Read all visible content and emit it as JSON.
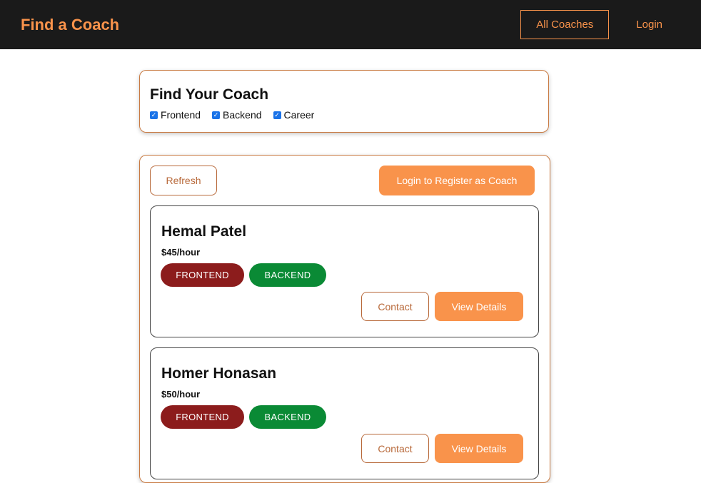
{
  "header": {
    "brand": "Find a Coach",
    "nav": [
      "All Coaches",
      "Login"
    ]
  },
  "filter": {
    "title": "Find Your Coach",
    "options": [
      {
        "label": "Frontend",
        "checked": true
      },
      {
        "label": "Backend",
        "checked": true
      },
      {
        "label": "Career",
        "checked": true
      }
    ]
  },
  "actions": {
    "refresh": "Refresh",
    "register": "Login to Register as Coach"
  },
  "coaches": [
    {
      "name": "Hemal Patel",
      "rate": "$45/hour",
      "areas": [
        "FRONTEND",
        "BACKEND"
      ],
      "contact": "Contact",
      "details": "View Details"
    },
    {
      "name": "Homer Honasan",
      "rate": "$50/hour",
      "areas": [
        "FRONTEND",
        "BACKEND"
      ],
      "contact": "Contact",
      "details": "View Details"
    }
  ],
  "colors": {
    "accent": "#f9934b",
    "header_bg": "#1a1a1a",
    "badge_frontend": "#8c1c1c",
    "badge_backend": "#0a8a35",
    "checkbox": "#1a73e8"
  }
}
